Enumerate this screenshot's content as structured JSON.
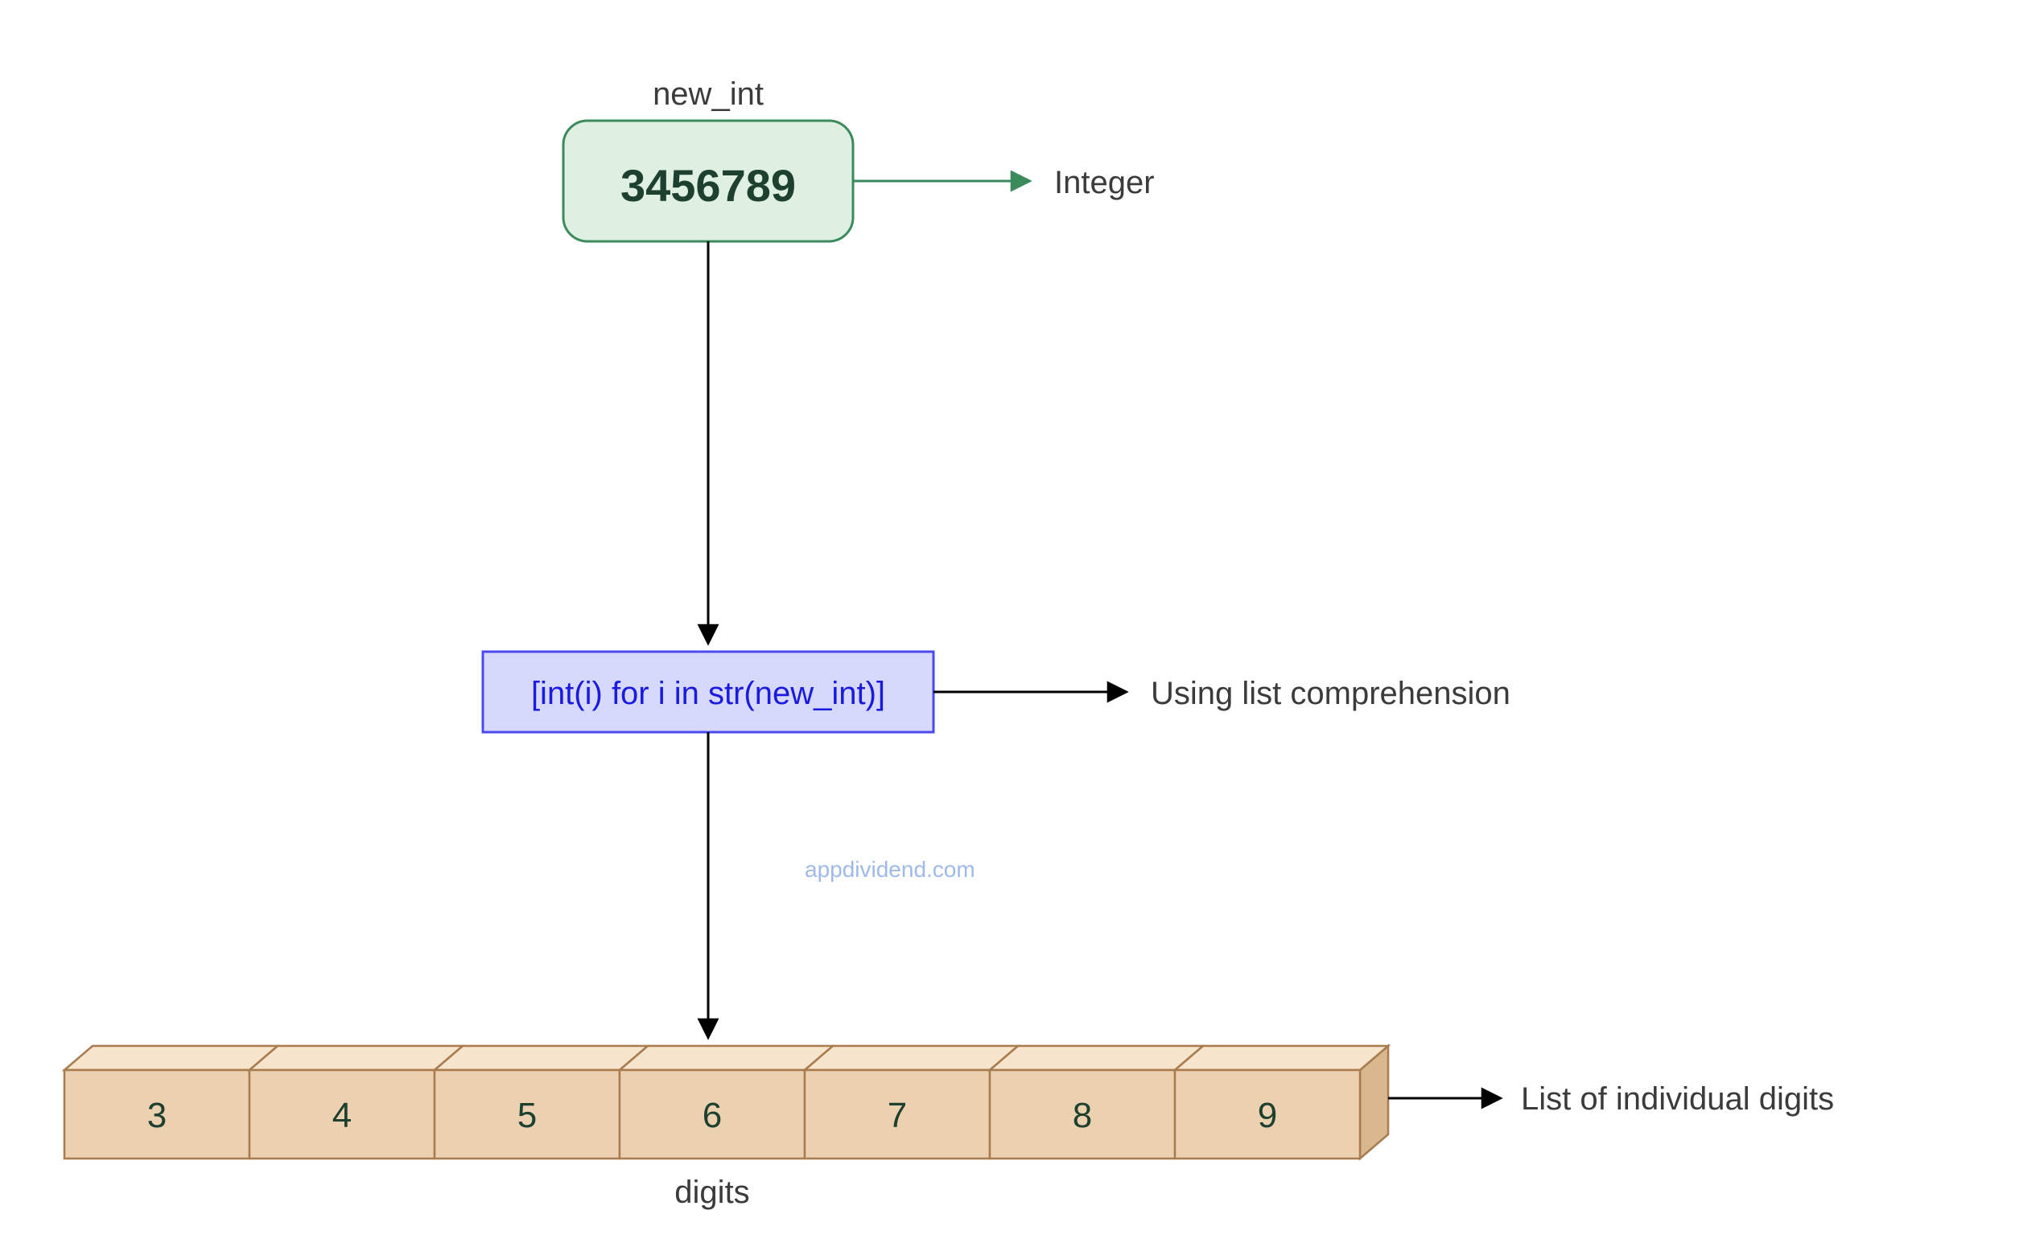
{
  "top": {
    "var_name": "new_int",
    "value": "3456789",
    "type_label": "Integer"
  },
  "middle": {
    "code": "[int(i) for i in str(new_int)]",
    "note": "Using list comprehension"
  },
  "watermark": "appdividend.com",
  "bottom": {
    "cells": [
      "3",
      "4",
      "5",
      "6",
      "7",
      "8",
      "9"
    ],
    "var_name": "digits",
    "type_label": "List of individual digits"
  },
  "colors": {
    "green_fill": "#dff0e3",
    "green_stroke": "#3a8a5c",
    "blue_fill": "#d6d9fb",
    "blue_stroke": "#4a4af0",
    "tan_fill": "#ecd1b0",
    "tan_stroke": "#a87c4f",
    "tan_top": "#f6e4cd",
    "tan_side": "#d9b890"
  }
}
